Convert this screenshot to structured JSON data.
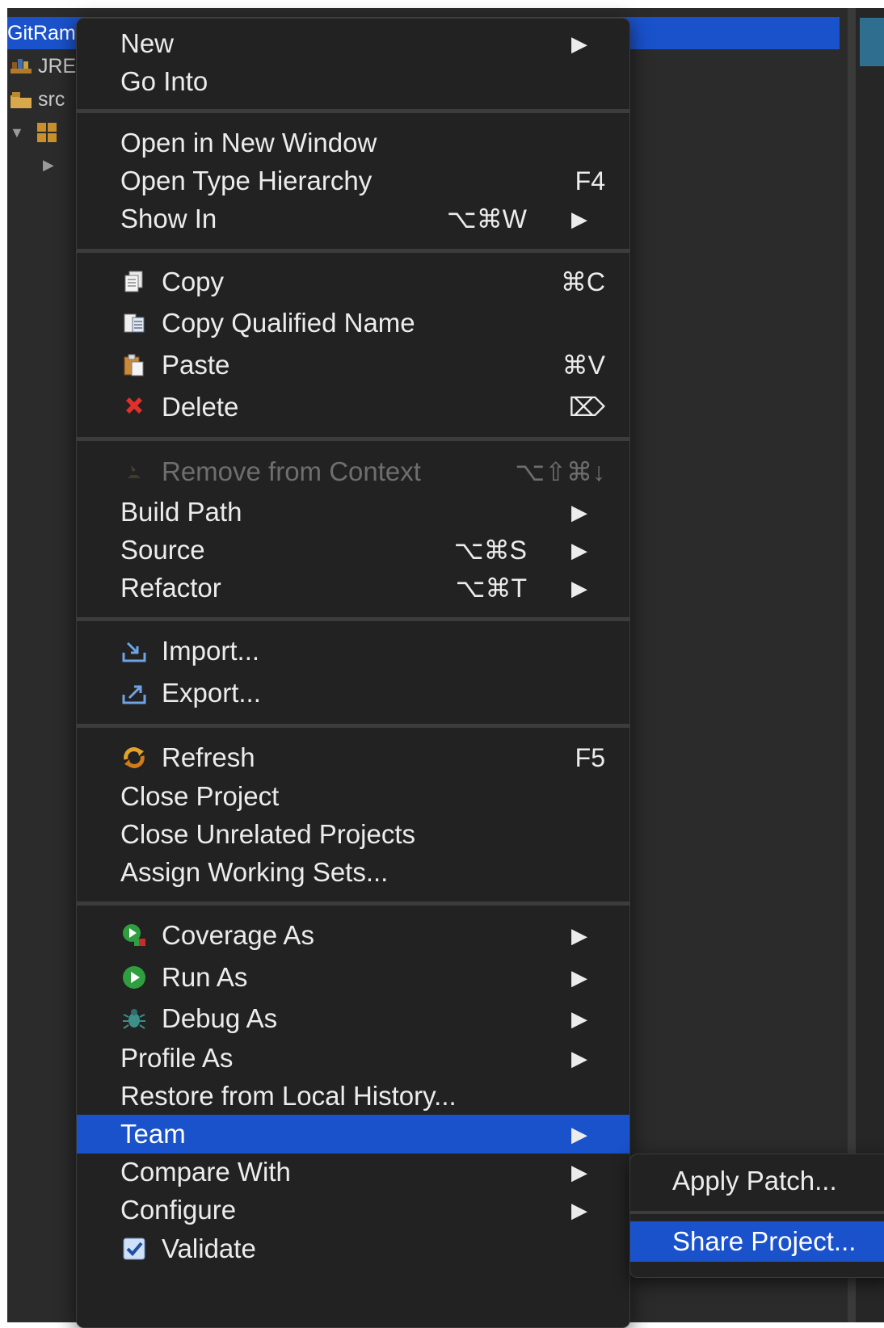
{
  "explorer": {
    "project_name": "GitRam",
    "items": [
      "JRE",
      "src",
      ""
    ]
  },
  "context_menu": {
    "groups": [
      [
        {
          "label": "New",
          "submenu": true
        },
        {
          "label": "Go Into"
        }
      ],
      [
        {
          "label": "Open in New Window"
        },
        {
          "label": "Open Type Hierarchy",
          "shortcut": "F4"
        },
        {
          "label": "Show In",
          "shortcut": "⌥⌘W",
          "submenu": true
        }
      ],
      [
        {
          "label": "Copy",
          "icon": "copy-icon",
          "shortcut": "⌘C"
        },
        {
          "label": "Copy Qualified Name",
          "icon": "copy-qualified-name-icon"
        },
        {
          "label": "Paste",
          "icon": "paste-icon",
          "shortcut": "⌘V"
        },
        {
          "label": "Delete",
          "icon": "delete-icon",
          "shortcut": "⌦"
        }
      ],
      [
        {
          "label": "Remove from Context",
          "icon": "remove-context-icon",
          "shortcut": "⌥⇧⌘↓",
          "disabled": true
        },
        {
          "label": "Build Path",
          "submenu": true
        },
        {
          "label": "Source",
          "shortcut": "⌥⌘S",
          "submenu": true
        },
        {
          "label": "Refactor",
          "shortcut": "⌥⌘T",
          "submenu": true
        }
      ],
      [
        {
          "label": "Import...",
          "icon": "import-icon"
        },
        {
          "label": "Export...",
          "icon": "export-icon"
        }
      ],
      [
        {
          "label": "Refresh",
          "icon": "refresh-icon",
          "shortcut": "F5"
        },
        {
          "label": "Close Project"
        },
        {
          "label": "Close Unrelated Projects"
        },
        {
          "label": "Assign Working Sets..."
        }
      ],
      [
        {
          "label": "Coverage As",
          "icon": "coverage-icon",
          "submenu": true
        },
        {
          "label": "Run As",
          "icon": "run-icon",
          "submenu": true
        },
        {
          "label": "Debug As",
          "icon": "debug-bug-icon",
          "submenu": true
        },
        {
          "label": "Profile As",
          "submenu": true
        },
        {
          "label": "Restore from Local History..."
        },
        {
          "label": "Team",
          "submenu": true,
          "highlighted": true
        },
        {
          "label": "Compare With",
          "submenu": true
        },
        {
          "label": "Configure",
          "submenu": true
        },
        {
          "label": "Validate",
          "icon": "validate-check-icon"
        }
      ]
    ],
    "submenu_arrow": "▶"
  },
  "team_submenu": {
    "items": [
      {
        "label": "Apply Patch..."
      },
      {
        "label": "Share Project...",
        "highlighted": true
      }
    ]
  },
  "colors": {
    "menu_bg": "#222222",
    "highlight": "#1a52cc",
    "text": "#ececec",
    "disabled_text": "#6e6e6e",
    "separator": "#3c3c3c"
  }
}
